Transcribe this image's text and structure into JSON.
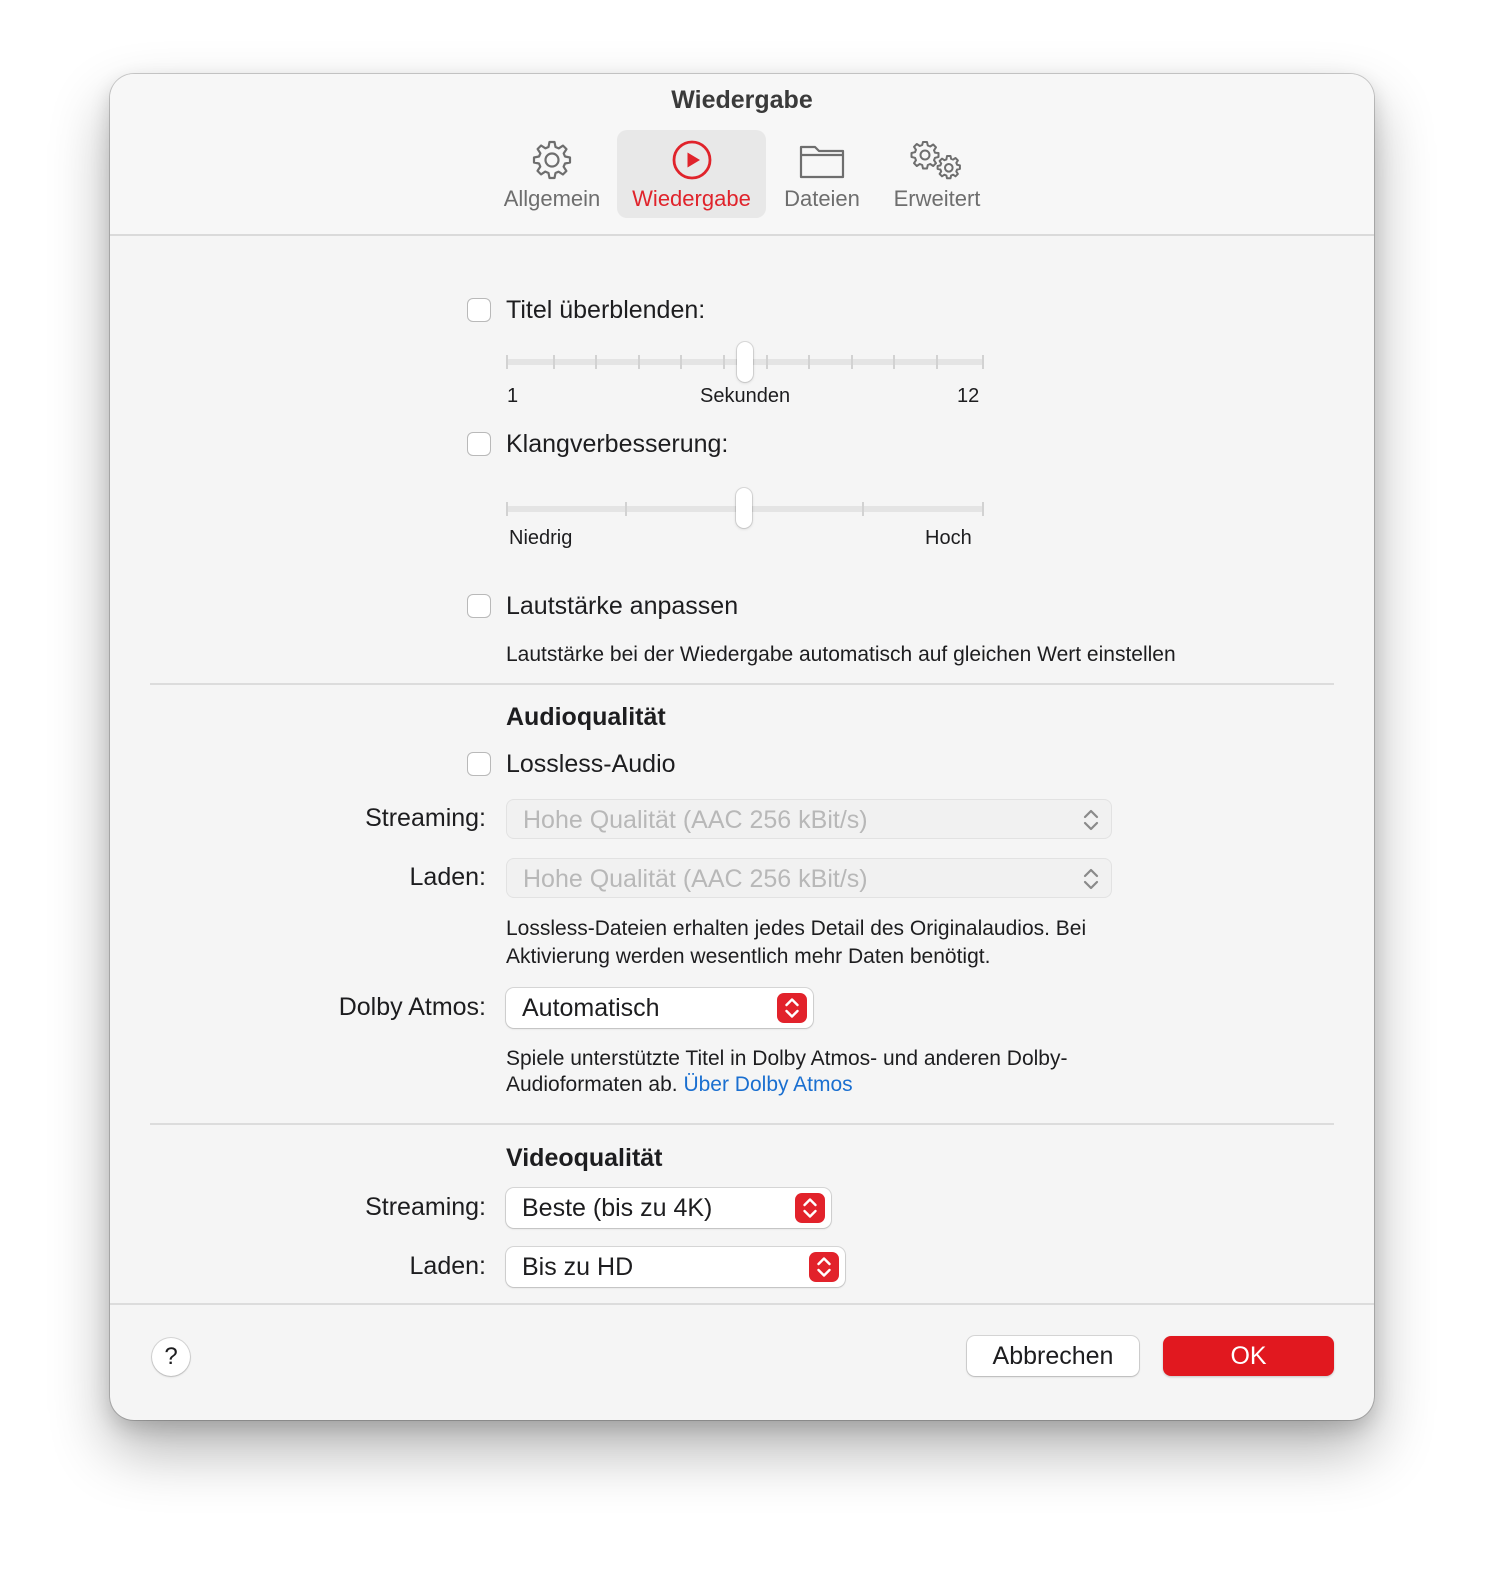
{
  "window": {
    "title": "Wiedergabe"
  },
  "tabs": [
    {
      "label": "Allgemein",
      "icon": "gear-icon",
      "active": false
    },
    {
      "label": "Wiedergabe",
      "icon": "play-circle-icon",
      "active": true
    },
    {
      "label": "Dateien",
      "icon": "folder-icon",
      "active": false
    },
    {
      "label": "Erweitert",
      "icon": "gears-icon",
      "active": false
    }
  ],
  "crossfade": {
    "label": "Titel überblenden:",
    "checked": false,
    "slider": {
      "min_label": "1",
      "unit_label": "Sekunden",
      "max_label": "12",
      "value_fraction": 0.5
    }
  },
  "sound_enhancer": {
    "label": "Klangverbesserung:",
    "checked": false,
    "slider": {
      "low_label": "Niedrig",
      "high_label": "Hoch",
      "value_fraction": 0.5
    }
  },
  "sound_check": {
    "label": "Lautstärke anpassen",
    "checked": false,
    "description": "Lautstärke bei der Wiedergabe automatisch auf gleichen Wert einstellen"
  },
  "audio_quality": {
    "heading": "Audioqualität",
    "lossless_label": "Lossless-Audio",
    "lossless_checked": false,
    "streaming_label": "Streaming:",
    "streaming_value": "Hohe Qualität (AAC 256 kBit/s)",
    "download_label": "Laden:",
    "download_value": "Hohe Qualität (AAC 256 kBit/s)",
    "lossless_note_line1": "Lossless-Dateien erhalten jedes Detail des Originalaudios. Bei",
    "lossless_note_line2": "Aktivierung werden wesentlich mehr Daten benötigt.",
    "dolby_label": "Dolby Atmos:",
    "dolby_value": "Automatisch",
    "dolby_note_line1": "Spiele unterstützte Titel in Dolby Atmos- und anderen Dolby-",
    "dolby_note_line2": "Audioformaten ab.",
    "dolby_link": "Über Dolby Atmos"
  },
  "video_quality": {
    "heading": "Videoqualität",
    "streaming_label": "Streaming:",
    "streaming_value": "Beste (bis zu 4K)",
    "download_label": "Laden:",
    "download_value": "Bis zu HD"
  },
  "footer": {
    "help_label": "?",
    "cancel_label": "Abbrechen",
    "ok_label": "OK"
  },
  "colors": {
    "accent": "#e1181f",
    "link": "#1a6fd0",
    "background": "#f5f5f5"
  }
}
